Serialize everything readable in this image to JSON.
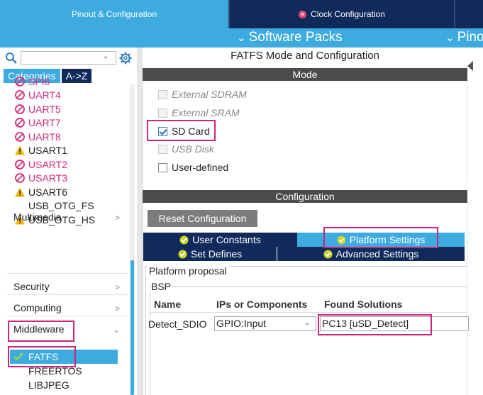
{
  "top_tabs": {
    "pinout": "Pinout & Configuration",
    "clock": "Clock Configuration",
    "clock_status_icon": "error-x-icon"
  },
  "subbar": {
    "software_packs": "Software Packs",
    "pinout": "Pino"
  },
  "left_panel": {
    "search": {
      "value": "",
      "placeholder": ""
    },
    "tabs": {
      "categories": "Categories",
      "az": "A->Z"
    },
    "peripherals": [
      {
        "label": "SPI6",
        "status": "disabled"
      },
      {
        "label": "UART4",
        "status": "disabled"
      },
      {
        "label": "UART5",
        "status": "disabled"
      },
      {
        "label": "UART7",
        "status": "disabled"
      },
      {
        "label": "UART8",
        "status": "disabled"
      },
      {
        "label": "USART1",
        "status": "warning"
      },
      {
        "label": "USART2",
        "status": "disabled"
      },
      {
        "label": "USART3",
        "status": "disabled"
      },
      {
        "label": "USART6",
        "status": "warning"
      },
      {
        "label": "USB_OTG_FS",
        "status": "none"
      },
      {
        "label": "USB_OTG_HS",
        "status": "warning"
      }
    ],
    "sections": {
      "multimedia": "Multimedia",
      "security": "Security",
      "computing": "Computing",
      "middleware": "Middleware"
    },
    "middleware_items": {
      "fatfs": "FATFS",
      "freertos": "FREERTOS",
      "libjpeg": "LIBJPEG"
    }
  },
  "right_panel": {
    "title": "FATFS Mode and Configuration",
    "mode_band": "Mode",
    "mode_options": {
      "external_sdram": "External SDRAM",
      "external_sram": "External SRAM",
      "sd_card": "SD Card",
      "usb_disk": "USB Disk",
      "user_defined": "User-defined"
    },
    "config_band": "Configuration",
    "reset_button": "Reset Configuration",
    "config_tabs": {
      "user_constants": "User Constants",
      "platform_settings": "Platform Settings",
      "set_defines": "Set Defines",
      "advanced_settings": "Advanced Settings"
    },
    "platform_legend": "Platform proposal",
    "bsp_legend": "BSP",
    "table": {
      "headers": {
        "name": "Name",
        "ips": "IPs or Components",
        "found": "Found Solutions"
      },
      "row": {
        "name": "Detect_SDIO",
        "ips": "GPIO:Input",
        "found": "PC13 [uSD_Detect]"
      }
    }
  },
  "colors": {
    "accent_blue": "#3eabe0",
    "navy": "#102a5c",
    "disabled_pink": "#d6287a",
    "highlight_magenta": "#c9257a",
    "band_gray": "#4b4b4b"
  }
}
